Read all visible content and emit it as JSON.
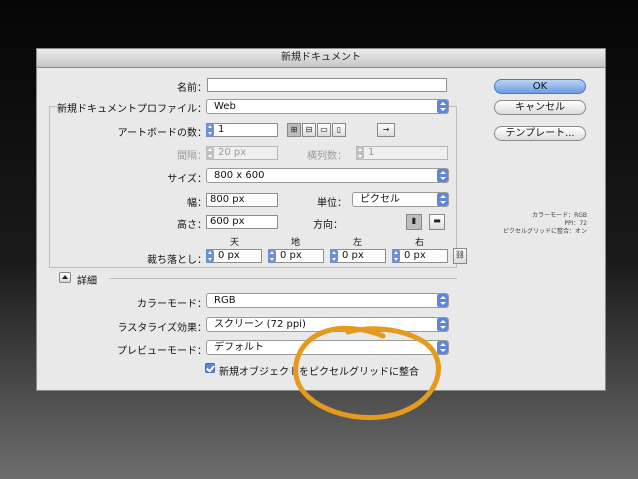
{
  "dialog": {
    "title": "新規ドキュメント"
  },
  "form": {
    "name_label": "名前：",
    "name_value": "",
    "profile_label": "新規ドキュメントプロファイル：",
    "profile_value": "Web",
    "artboards_label": "アートボードの数：",
    "artboards_value": "1",
    "spacing_label": "間隔：",
    "spacing_value": "20 px",
    "columns_label": "横列数：",
    "columns_value": "1",
    "size_label": "サイズ：",
    "size_value": "800 x 600",
    "width_label": "幅：",
    "width_value": "800 px",
    "units_label": "単位：",
    "units_value": "ピクセル",
    "height_label": "高さ：",
    "height_value": "600 px",
    "orientation_label": "方向：",
    "bleed_label": "裁ち落とし：",
    "bleed_headers": [
      "天",
      "地",
      "左",
      "右"
    ],
    "bleed_values": [
      "0 px",
      "0 px",
      "0 px",
      "0 px"
    ]
  },
  "advanced": {
    "label": "詳細",
    "color_mode_label": "カラーモード：",
    "color_mode_value": "RGB",
    "raster_label": "ラスタライズ効果：",
    "raster_value": "スクリーン (72 ppi)",
    "preview_label": "プレビューモード：",
    "preview_value": "デフォルト",
    "align_checkbox_label": "新規オブジェクトをピクセルグリッドに整合",
    "align_checked": true
  },
  "buttons": {
    "ok": "OK",
    "cancel": "キャンセル",
    "templates": "テンプレート..."
  },
  "info": {
    "line1": "カラーモード：RGB",
    "line2": "PPI：72",
    "line3": "ピクセルグリッドに整合：オン"
  },
  "arrange_icons": [
    "grid-by-row-icon",
    "grid-by-column-icon",
    "arrange-by-row-icon",
    "arrange-by-column-icon",
    "right-to-left-icon"
  ],
  "annotation_color": "#e39a1f"
}
